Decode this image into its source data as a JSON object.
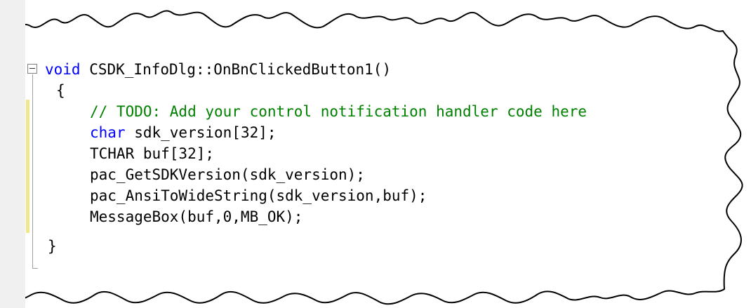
{
  "editor": {
    "lines": [
      {
        "keyword": "void",
        "rest": " CSDK_InfoDlg::OnBnClickedButton1()"
      },
      {
        "text": "{"
      },
      {
        "comment": "// TODO: Add your control notification handler code here"
      },
      {
        "keyword": "char",
        "rest": " sdk_version[32];"
      },
      {
        "text": "TCHAR buf[32];"
      },
      {
        "text": "pac_GetSDKVersion(sdk_version);"
      },
      {
        "text": "pac_AnsiToWideString(sdk_version,buf);"
      },
      {
        "text": "MessageBox(buf,0,MB_OK);"
      },
      {
        "text": "}"
      }
    ]
  },
  "colors": {
    "keyword": "#0000ff",
    "comment": "#008000",
    "text": "#000000",
    "change_bar": "#f0e68c"
  },
  "icons": {
    "fold_toggle": "minus-box-icon"
  }
}
